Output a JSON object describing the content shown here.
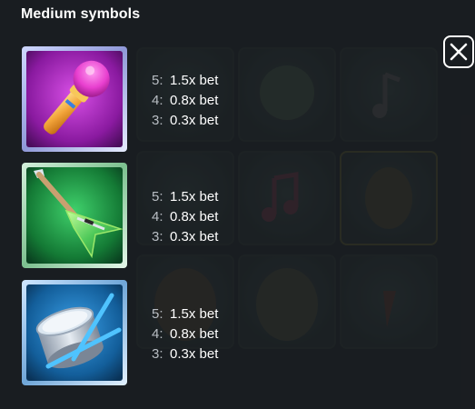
{
  "section": {
    "title": "Medium symbols"
  },
  "close_button": {
    "icon": "close-icon"
  },
  "symbols": [
    {
      "icon": "microphone-icon",
      "frame_color": "#c23ad6",
      "payouts": [
        {
          "count": "5:",
          "value": "1.5x bet"
        },
        {
          "count": "4:",
          "value": "0.8x bet"
        },
        {
          "count": "3:",
          "value": "0.3x bet"
        }
      ]
    },
    {
      "icon": "electric-guitar-icon",
      "frame_color": "#25a455",
      "payouts": [
        {
          "count": "5:",
          "value": "1.5x bet"
        },
        {
          "count": "4:",
          "value": "0.8x bet"
        },
        {
          "count": "3:",
          "value": "0.3x bet"
        }
      ]
    },
    {
      "icon": "drum-icon",
      "frame_color": "#1f7fc0",
      "payouts": [
        {
          "count": "5:",
          "value": "1.5x bet"
        },
        {
          "count": "4:",
          "value": "0.8x bet"
        },
        {
          "count": "3:",
          "value": "0.3x bet"
        }
      ]
    }
  ]
}
